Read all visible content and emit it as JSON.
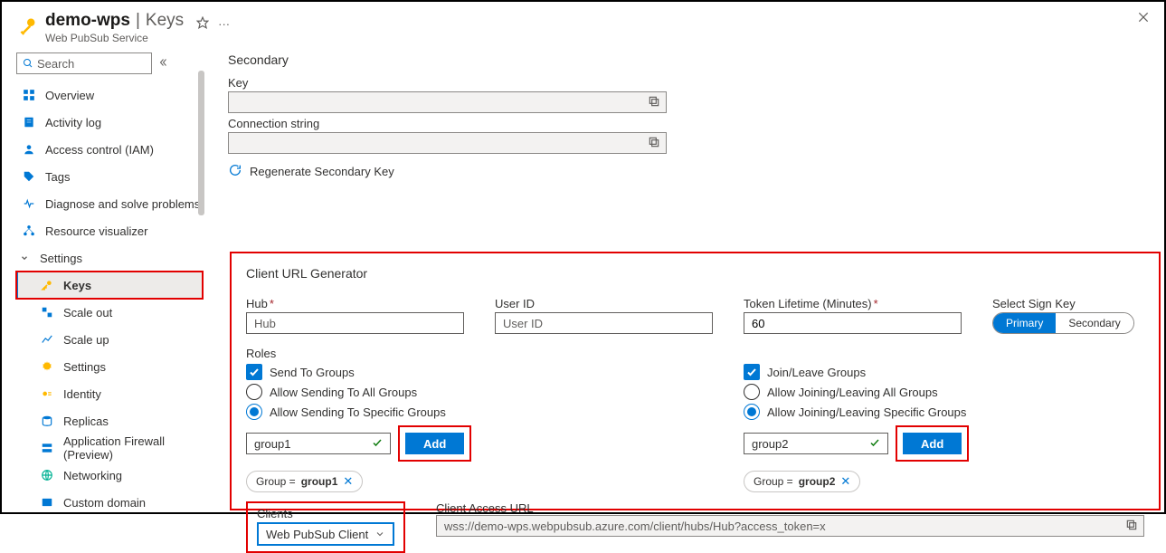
{
  "header": {
    "resource_name": "demo-wps",
    "section": "Keys",
    "service_type": "Web PubSub Service"
  },
  "sidebar": {
    "search_placeholder": "Search",
    "items": [
      {
        "label": "Overview"
      },
      {
        "label": "Activity log"
      },
      {
        "label": "Access control (IAM)"
      },
      {
        "label": "Tags"
      },
      {
        "label": "Diagnose and solve problems"
      },
      {
        "label": "Resource visualizer"
      }
    ],
    "settings_label": "Settings",
    "settings_children": [
      {
        "label": "Keys"
      },
      {
        "label": "Scale out"
      },
      {
        "label": "Scale up"
      },
      {
        "label": "Settings"
      },
      {
        "label": "Identity"
      },
      {
        "label": "Replicas"
      },
      {
        "label": "Application Firewall (Preview)"
      },
      {
        "label": "Networking"
      },
      {
        "label": "Custom domain"
      }
    ]
  },
  "secondary": {
    "title": "Secondary",
    "key_label": "Key",
    "conn_label": "Connection string",
    "regen": "Regenerate Secondary Key"
  },
  "generator": {
    "title": "Client URL Generator",
    "hub_label": "Hub",
    "hub_placeholder": "Hub",
    "userid_label": "User ID",
    "userid_placeholder": "User ID",
    "token_label": "Token Lifetime (Minutes)",
    "token_value": "60",
    "signkey_label": "Select Sign Key",
    "signkey_primary": "Primary",
    "signkey_secondary": "Secondary",
    "roles_label": "Roles",
    "send_check": "Send To Groups",
    "send_radio_all": "Allow Sending To All Groups",
    "send_radio_specific": "Allow Sending To Specific Groups",
    "send_group_value": "group1",
    "send_group_chip_prefix": "Group = ",
    "send_group_chip": "group1",
    "join_check": "Join/Leave Groups",
    "join_radio_all": "Allow Joining/Leaving All Groups",
    "join_radio_specific": "Allow Joining/Leaving Specific Groups",
    "join_group_value": "group2",
    "join_group_chip": "group2",
    "add_btn": "Add",
    "clients_label": "Clients",
    "clients_value": "Web PubSub Client",
    "url_label": "Client Access URL",
    "url_value": "wss://demo-wps.webpubsub.azure.com/client/hubs/Hub?access_token=x"
  }
}
